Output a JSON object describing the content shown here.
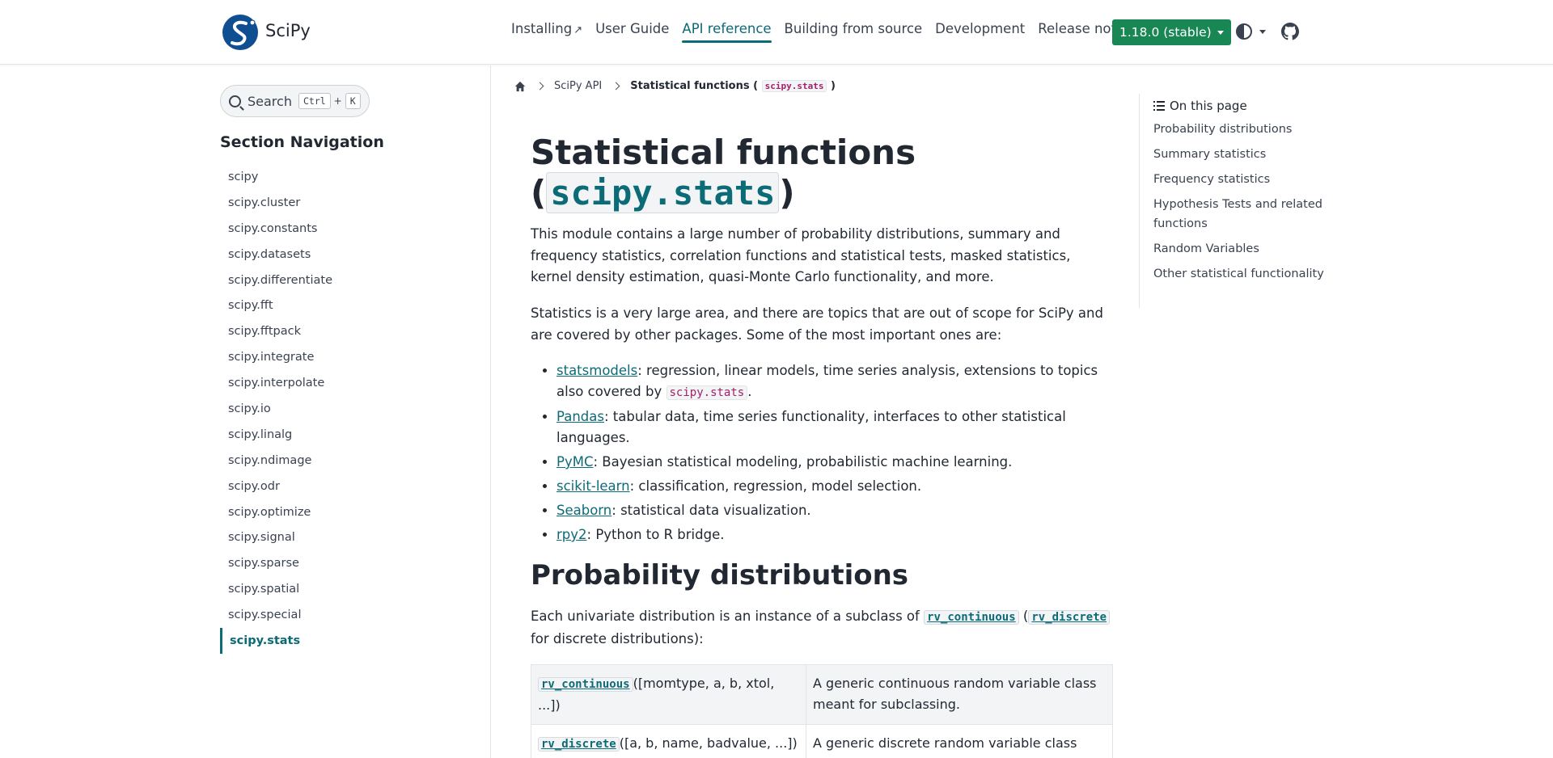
{
  "header": {
    "brand": "SciPy",
    "nav": [
      {
        "label": "Installing",
        "external": true
      },
      {
        "label": "User Guide"
      },
      {
        "label": "API reference",
        "active": true
      },
      {
        "label": "Building from source"
      },
      {
        "label": "Development"
      },
      {
        "label": "Release notes"
      }
    ],
    "version_label": "1.18.0 (stable)",
    "accent_color": "#0b6b77",
    "version_color": "#198754"
  },
  "sidebar": {
    "search_label": "Search",
    "search_key1": "Ctrl",
    "search_plus": "+",
    "search_key2": "K",
    "section_title": "Section Navigation",
    "items": [
      "scipy",
      "scipy.cluster",
      "scipy.constants",
      "scipy.datasets",
      "scipy.differentiate",
      "scipy.fft",
      "scipy.fftpack",
      "scipy.integrate",
      "scipy.interpolate",
      "scipy.io",
      "scipy.linalg",
      "scipy.ndimage",
      "scipy.odr",
      "scipy.optimize",
      "scipy.signal",
      "scipy.sparse",
      "scipy.spatial",
      "scipy.special",
      "scipy.stats"
    ],
    "active_item": "scipy.stats"
  },
  "breadcrumb": {
    "crumb1": "SciPy API",
    "current_text": "Statistical functions (",
    "current_code": "scipy.stats",
    "current_close": ")"
  },
  "main": {
    "title_line1": "Statistical functions",
    "title_open": "(",
    "title_code": "scipy.stats",
    "title_close": ")",
    "para1": "This module contains a large number of probability distributions, summary and frequency statistics, correlation functions and statistical tests, masked statistics, kernel density estimation, quasi-Monte Carlo functionality, and more.",
    "para2": "Statistics is a very large area, and there are topics that are out of scope for SciPy and are covered by other packages. Some of the most important ones are:",
    "tools": [
      {
        "name": "statsmodels",
        "desc": ": regression, linear models, time series analysis, extensions to topics also covered by ",
        "code": "scipy.stats",
        "tail": "."
      },
      {
        "name": "Pandas",
        "desc": ": tabular data, time series functionality, interfaces to other statistical languages."
      },
      {
        "name": "PyMC",
        "desc": ": Bayesian statistical modeling, probabilistic machine learning."
      },
      {
        "name": "scikit-learn",
        "desc": ": classification, regression, model selection."
      },
      {
        "name": "Seaborn",
        "desc": ": statistical data visualization."
      },
      {
        "name": "rpy2",
        "desc": ": Python to R bridge."
      }
    ],
    "h2": "Probability distributions",
    "para3_pre": "Each univariate distribution is an instance of a subclass of ",
    "para3_code1": "rv_continuous",
    "para3_mid": " (",
    "para3_code2": "rv_discrete",
    "para3_post": " for discrete distributions):",
    "table": [
      {
        "code": "rv_continuous",
        "args": "([momtype, a, b, xtol, ...])",
        "desc": "A generic continuous random variable class meant for subclassing."
      },
      {
        "code": "rv_discrete",
        "args": "([a, b, name, badvalue, ...])",
        "desc": "A generic discrete random variable class meant for subclassing."
      }
    ]
  },
  "toc": {
    "title": "On this page",
    "items": [
      "Probability distributions",
      "Summary statistics",
      "Frequency statistics",
      "Hypothesis Tests and related functions",
      "Random Variables",
      "Other statistical functionality"
    ]
  }
}
